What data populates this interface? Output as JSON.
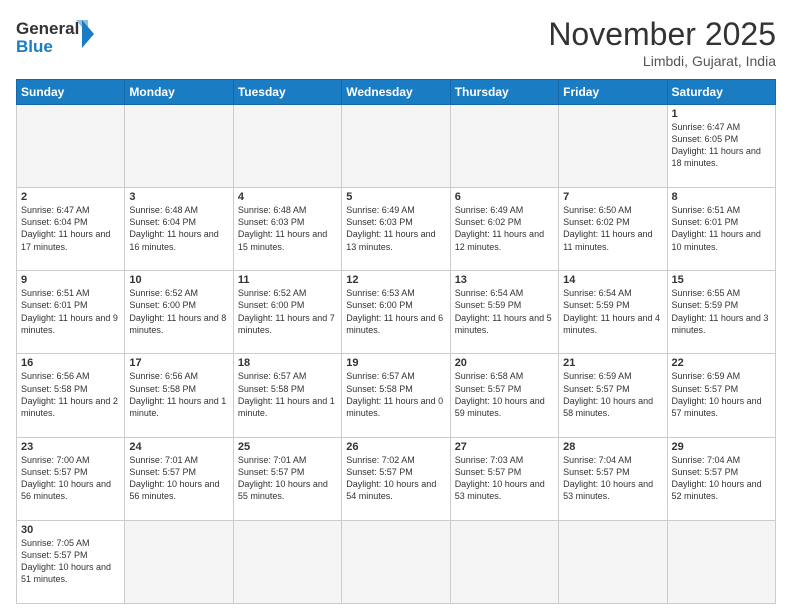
{
  "logo": {
    "text_general": "General",
    "text_blue": "Blue"
  },
  "header": {
    "month": "November 2025",
    "location": "Limbdi, Gujarat, India"
  },
  "weekdays": [
    "Sunday",
    "Monday",
    "Tuesday",
    "Wednesday",
    "Thursday",
    "Friday",
    "Saturday"
  ],
  "weeks": [
    [
      {
        "day": "",
        "info": ""
      },
      {
        "day": "",
        "info": ""
      },
      {
        "day": "",
        "info": ""
      },
      {
        "day": "",
        "info": ""
      },
      {
        "day": "",
        "info": ""
      },
      {
        "day": "",
        "info": ""
      },
      {
        "day": "1",
        "info": "Sunrise: 6:47 AM\nSunset: 6:05 PM\nDaylight: 11 hours\nand 18 minutes."
      }
    ],
    [
      {
        "day": "2",
        "info": "Sunrise: 6:47 AM\nSunset: 6:04 PM\nDaylight: 11 hours\nand 17 minutes."
      },
      {
        "day": "3",
        "info": "Sunrise: 6:48 AM\nSunset: 6:04 PM\nDaylight: 11 hours\nand 16 minutes."
      },
      {
        "day": "4",
        "info": "Sunrise: 6:48 AM\nSunset: 6:03 PM\nDaylight: 11 hours\nand 15 minutes."
      },
      {
        "day": "5",
        "info": "Sunrise: 6:49 AM\nSunset: 6:03 PM\nDaylight: 11 hours\nand 13 minutes."
      },
      {
        "day": "6",
        "info": "Sunrise: 6:49 AM\nSunset: 6:02 PM\nDaylight: 11 hours\nand 12 minutes."
      },
      {
        "day": "7",
        "info": "Sunrise: 6:50 AM\nSunset: 6:02 PM\nDaylight: 11 hours\nand 11 minutes."
      },
      {
        "day": "8",
        "info": "Sunrise: 6:51 AM\nSunset: 6:01 PM\nDaylight: 11 hours\nand 10 minutes."
      }
    ],
    [
      {
        "day": "9",
        "info": "Sunrise: 6:51 AM\nSunset: 6:01 PM\nDaylight: 11 hours\nand 9 minutes."
      },
      {
        "day": "10",
        "info": "Sunrise: 6:52 AM\nSunset: 6:00 PM\nDaylight: 11 hours\nand 8 minutes."
      },
      {
        "day": "11",
        "info": "Sunrise: 6:52 AM\nSunset: 6:00 PM\nDaylight: 11 hours\nand 7 minutes."
      },
      {
        "day": "12",
        "info": "Sunrise: 6:53 AM\nSunset: 6:00 PM\nDaylight: 11 hours\nand 6 minutes."
      },
      {
        "day": "13",
        "info": "Sunrise: 6:54 AM\nSunset: 5:59 PM\nDaylight: 11 hours\nand 5 minutes."
      },
      {
        "day": "14",
        "info": "Sunrise: 6:54 AM\nSunset: 5:59 PM\nDaylight: 11 hours\nand 4 minutes."
      },
      {
        "day": "15",
        "info": "Sunrise: 6:55 AM\nSunset: 5:59 PM\nDaylight: 11 hours\nand 3 minutes."
      }
    ],
    [
      {
        "day": "16",
        "info": "Sunrise: 6:56 AM\nSunset: 5:58 PM\nDaylight: 11 hours\nand 2 minutes."
      },
      {
        "day": "17",
        "info": "Sunrise: 6:56 AM\nSunset: 5:58 PM\nDaylight: 11 hours\nand 1 minute."
      },
      {
        "day": "18",
        "info": "Sunrise: 6:57 AM\nSunset: 5:58 PM\nDaylight: 11 hours\nand 1 minute."
      },
      {
        "day": "19",
        "info": "Sunrise: 6:57 AM\nSunset: 5:58 PM\nDaylight: 11 hours\nand 0 minutes."
      },
      {
        "day": "20",
        "info": "Sunrise: 6:58 AM\nSunset: 5:57 PM\nDaylight: 10 hours\nand 59 minutes."
      },
      {
        "day": "21",
        "info": "Sunrise: 6:59 AM\nSunset: 5:57 PM\nDaylight: 10 hours\nand 58 minutes."
      },
      {
        "day": "22",
        "info": "Sunrise: 6:59 AM\nSunset: 5:57 PM\nDaylight: 10 hours\nand 57 minutes."
      }
    ],
    [
      {
        "day": "23",
        "info": "Sunrise: 7:00 AM\nSunset: 5:57 PM\nDaylight: 10 hours\nand 56 minutes."
      },
      {
        "day": "24",
        "info": "Sunrise: 7:01 AM\nSunset: 5:57 PM\nDaylight: 10 hours\nand 56 minutes."
      },
      {
        "day": "25",
        "info": "Sunrise: 7:01 AM\nSunset: 5:57 PM\nDaylight: 10 hours\nand 55 minutes."
      },
      {
        "day": "26",
        "info": "Sunrise: 7:02 AM\nSunset: 5:57 PM\nDaylight: 10 hours\nand 54 minutes."
      },
      {
        "day": "27",
        "info": "Sunrise: 7:03 AM\nSunset: 5:57 PM\nDaylight: 10 hours\nand 53 minutes."
      },
      {
        "day": "28",
        "info": "Sunrise: 7:04 AM\nSunset: 5:57 PM\nDaylight: 10 hours\nand 53 minutes."
      },
      {
        "day": "29",
        "info": "Sunrise: 7:04 AM\nSunset: 5:57 PM\nDaylight: 10 hours\nand 52 minutes."
      }
    ],
    [
      {
        "day": "30",
        "info": "Sunrise: 7:05 AM\nSunset: 5:57 PM\nDaylight: 10 hours\nand 51 minutes."
      },
      {
        "day": "",
        "info": ""
      },
      {
        "day": "",
        "info": ""
      },
      {
        "day": "",
        "info": ""
      },
      {
        "day": "",
        "info": ""
      },
      {
        "day": "",
        "info": ""
      },
      {
        "day": "",
        "info": ""
      }
    ]
  ]
}
